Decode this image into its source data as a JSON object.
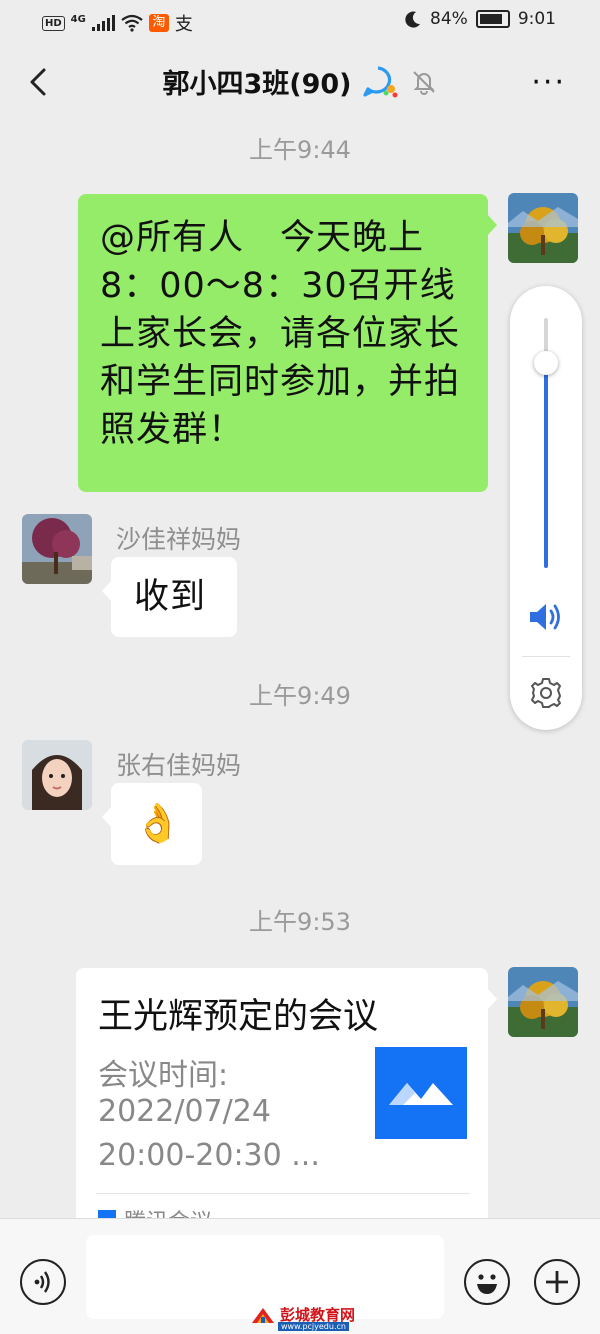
{
  "status_bar": {
    "network": "HD",
    "signal": "4G",
    "battery_percent": "84%",
    "time": "9:01"
  },
  "header": {
    "title": "郭小四3班(90)"
  },
  "messages": [
    {
      "time": "上午9:44"
    },
    {
      "text": "@所有人　今天晚上8：00～8：30召开线上家长会，请各位家长和学生同时参加，并拍照发群！"
    },
    {
      "sender": "沙佳祥妈妈",
      "text": "收到"
    },
    {
      "time": "上午9:49"
    },
    {
      "sender": "张右佳妈妈",
      "emoji": "👌"
    },
    {
      "time": "上午9:53"
    },
    {
      "card_title": "王光辉预定的会议",
      "card_label": "会议时间:",
      "card_date": "2022/07/24",
      "card_time": "20:00-20:30 ...",
      "card_source": "腾讯会议"
    }
  ],
  "volume_panel": {
    "level": 0.82
  },
  "watermark": {
    "text": "彭城教育网",
    "url": "www.pcjyedu.cn"
  },
  "colors": {
    "sent_bubble": "#95ec69",
    "background": "#ededed",
    "volume_accent": "#2f6fe0"
  }
}
